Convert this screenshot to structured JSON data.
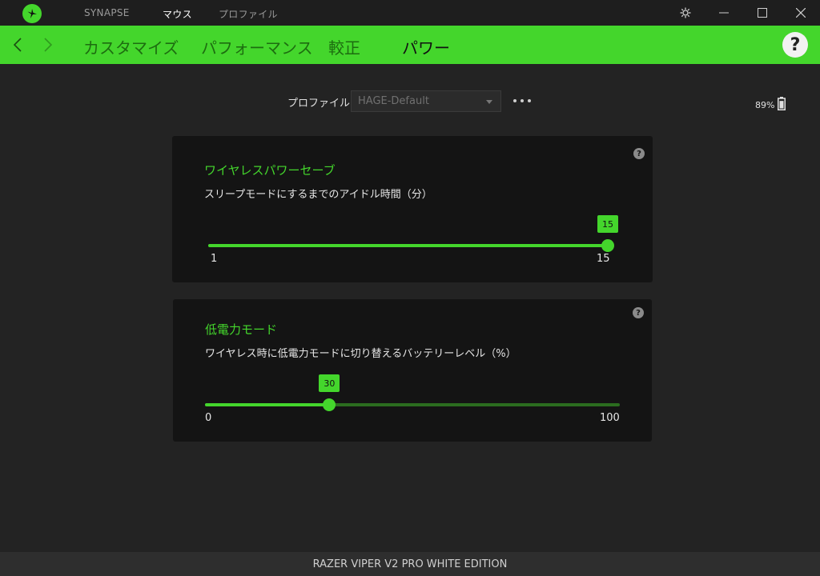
{
  "titlebar": {
    "tabs": [
      {
        "label": "SYNAPSE",
        "active": false
      },
      {
        "label": "マウス",
        "active": true
      },
      {
        "label": "プロファイル",
        "active": false
      }
    ],
    "icons": [
      "settings-icon",
      "minimize-icon",
      "maximize-icon",
      "close-icon"
    ]
  },
  "navbar": {
    "tabs": [
      {
        "label": "カスタマイズ",
        "active": false
      },
      {
        "label": "パフォーマンス",
        "active": false
      },
      {
        "label": "較正",
        "active": false
      },
      {
        "label": "パワー",
        "active": true
      }
    ],
    "help_label": "?"
  },
  "profile": {
    "label": "プロファイル",
    "selected": "HAGE-Default"
  },
  "battery": {
    "percent_text": "89%",
    "level": 0.89
  },
  "power_save": {
    "title": "ワイヤレスパワーセーブ",
    "description": "スリープモードにするまでのアイドル時間（分）",
    "min": 1,
    "max": 15,
    "value": 15,
    "min_label": "1",
    "max_label": "15",
    "value_label": "15"
  },
  "low_power": {
    "title": "低電力モード",
    "description": "ワイヤレス時に低電力モードに切り替えるバッテリーレベル（%）",
    "min": 0,
    "max": 100,
    "value": 30,
    "min_label": "0",
    "max_label": "100",
    "value_label": "30"
  },
  "footer": {
    "device_name": "RAZER VIPER V2 PRO WHITE EDITION"
  },
  "colors": {
    "accent": "#44d62c",
    "background": "#232323",
    "card": "#141414"
  }
}
